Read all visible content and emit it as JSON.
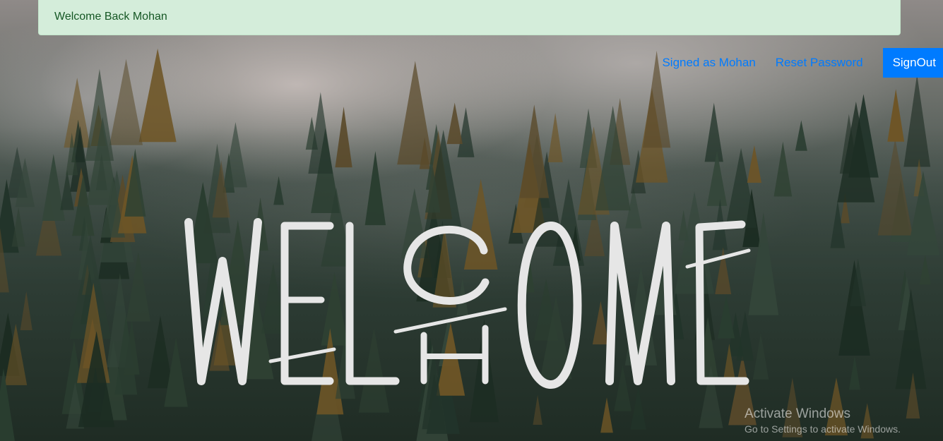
{
  "alert": {
    "message": "Welcome Back Mohan"
  },
  "nav": {
    "signed_as": "Signed as Mohan",
    "reset_password": "Reset Password",
    "signout": "SignOut"
  },
  "hero": {
    "text": "WELCOME"
  },
  "watermark": {
    "title": "Activate Windows",
    "subtitle": "Go to Settings to activate Windows."
  },
  "colors": {
    "alert_bg": "#d4edda",
    "alert_text": "#155724",
    "link": "#007bff",
    "button_bg": "#007bff"
  }
}
